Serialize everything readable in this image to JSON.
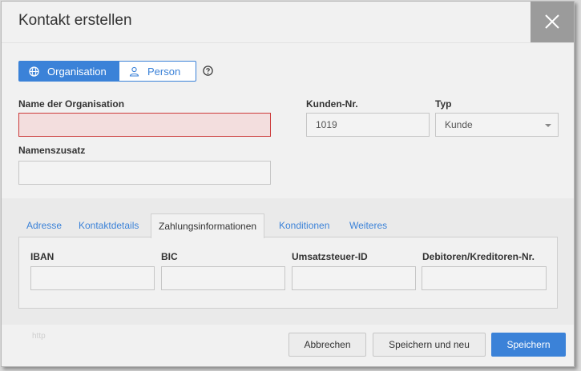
{
  "dialog": {
    "title": "Kontakt erstellen",
    "close_label": "×"
  },
  "type_toggle": {
    "organisation": "Organisation",
    "person": "Person"
  },
  "form": {
    "org_name_label": "Name der Organisation",
    "org_name_value": "",
    "name_suffix_label": "Namenszusatz",
    "name_suffix_value": "",
    "customer_no_label": "Kunden-Nr.",
    "customer_no_value": "1019",
    "type_label": "Typ",
    "type_value": "Kunde"
  },
  "tabs": [
    {
      "label": "Adresse"
    },
    {
      "label": "Kontaktdetails"
    },
    {
      "label": "Zahlungsinformationen",
      "active": true
    },
    {
      "label": "Konditionen"
    },
    {
      "label": "Weiteres"
    }
  ],
  "payment": {
    "iban_label": "IBAN",
    "iban_value": "",
    "bic_label": "BIC",
    "bic_value": "",
    "vat_label": "Umsatzsteuer-ID",
    "vat_value": "",
    "debtor_label": "Debitoren/Kreditoren-Nr.",
    "debtor_value": ""
  },
  "footer": {
    "logo_text": "http",
    "cancel": "Abbrechen",
    "save_new": "Speichern und neu",
    "save": "Speichern"
  },
  "colors": {
    "accent": "#3b82d8",
    "error_bg": "#f3dede",
    "error_border": "#cc3a3a"
  }
}
